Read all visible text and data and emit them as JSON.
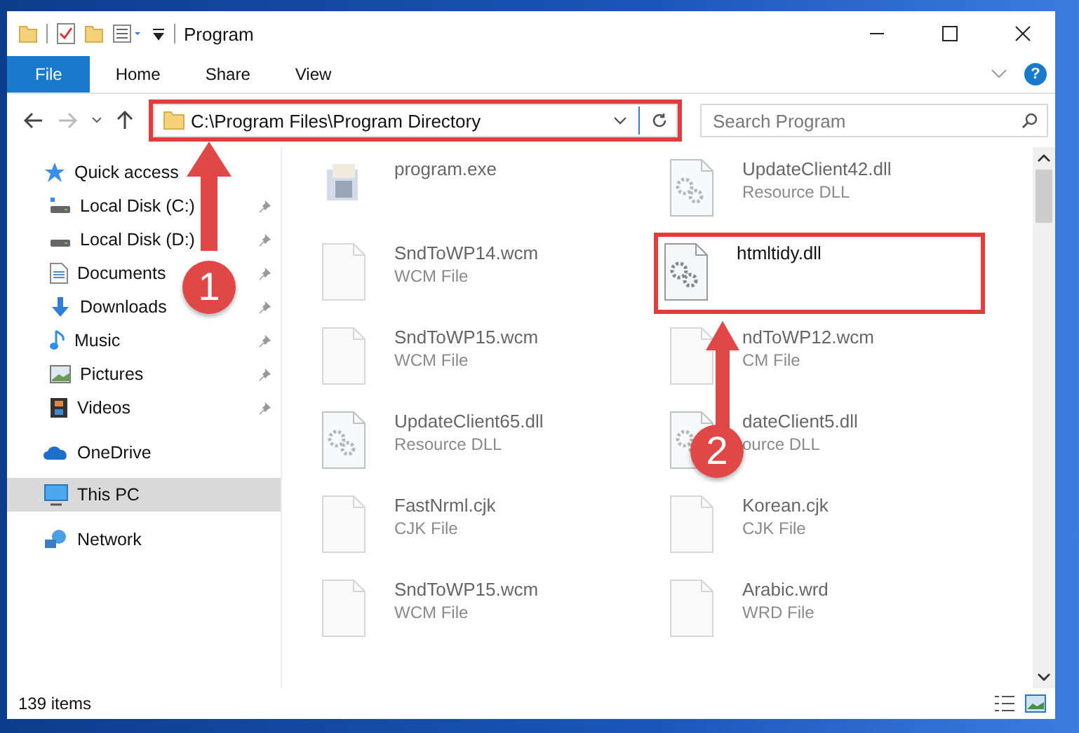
{
  "window": {
    "title": "Program"
  },
  "ribbon": {
    "tabs": [
      {
        "label": "File",
        "selected": true
      },
      {
        "label": "Home",
        "selected": false
      },
      {
        "label": "Share",
        "selected": false
      },
      {
        "label": "View",
        "selected": false
      }
    ],
    "help": "?"
  },
  "address_bar": {
    "path": "C:\\Program Files\\Program Directory",
    "highlighted": true
  },
  "search": {
    "placeholder": "Search Program"
  },
  "sidebar": {
    "items": [
      {
        "label": "Quick access",
        "kind": "quick",
        "pinned": false,
        "selected": false
      },
      {
        "label": "Local Disk (C:)",
        "kind": "sysdrive",
        "pinned": true,
        "selected": false
      },
      {
        "label": "Local Disk (D:)",
        "kind": "drive",
        "pinned": true,
        "selected": false
      },
      {
        "label": "Documents",
        "kind": "documents",
        "pinned": true,
        "selected": false
      },
      {
        "label": "Downloads",
        "kind": "downloads",
        "pinned": true,
        "selected": false
      },
      {
        "label": "Music",
        "kind": "music",
        "pinned": true,
        "selected": false
      },
      {
        "label": "Pictures",
        "kind": "pictures",
        "pinned": true,
        "selected": false
      },
      {
        "label": "Videos",
        "kind": "videos",
        "pinned": true,
        "selected": false
      },
      {
        "label": "OneDrive",
        "kind": "cloud",
        "pinned": false,
        "selected": false
      },
      {
        "label": "This PC",
        "kind": "pc",
        "pinned": false,
        "selected": true
      },
      {
        "label": "Network",
        "kind": "network",
        "pinned": false,
        "selected": false
      }
    ]
  },
  "files": [
    {
      "name": "program.exe",
      "kind": "exe",
      "blurred": true,
      "highlighted": false
    },
    {
      "name": "UpdateClient42.dll",
      "type": "Resource DLL",
      "kind": "dll",
      "blurred": true,
      "highlighted": false
    },
    {
      "name": "SndToWP14.wcm",
      "type": "WCM File",
      "kind": "blank",
      "blurred": true,
      "highlighted": false
    },
    {
      "name": "htmltidy.dll",
      "kind": "dll",
      "blurred": false,
      "highlighted": true
    },
    {
      "name": "SndToWP15.wcm",
      "type": "WCM File",
      "kind": "blank",
      "blurred": true,
      "highlighted": false
    },
    {
      "name": "ndToWP12.wcm",
      "type": "CM File",
      "kind": "blank",
      "blurred": true,
      "highlighted": false
    },
    {
      "name": "UpdateClient65.dll",
      "type": "Resource DLL",
      "kind": "dll",
      "blurred": true,
      "highlighted": false
    },
    {
      "name": "dateClient5.dll",
      "type": "ource DLL",
      "kind": "dll",
      "blurred": true,
      "highlighted": false
    },
    {
      "name": "FastNrml.cjk",
      "type": "CJK File",
      "kind": "blank",
      "blurred": true,
      "highlighted": false
    },
    {
      "name": "Korean.cjk",
      "type": "CJK File",
      "kind": "blank",
      "blurred": true,
      "highlighted": false
    },
    {
      "name": "SndToWP15.wcm",
      "type": "WCM File",
      "kind": "blank",
      "blurred": true,
      "highlighted": false
    },
    {
      "name": "Arabic.wrd",
      "type": "WRD File",
      "kind": "blank",
      "blurred": true,
      "highlighted": false
    }
  ],
  "callouts": [
    "1",
    "2"
  ],
  "status_bar": {
    "count": "139 items"
  }
}
